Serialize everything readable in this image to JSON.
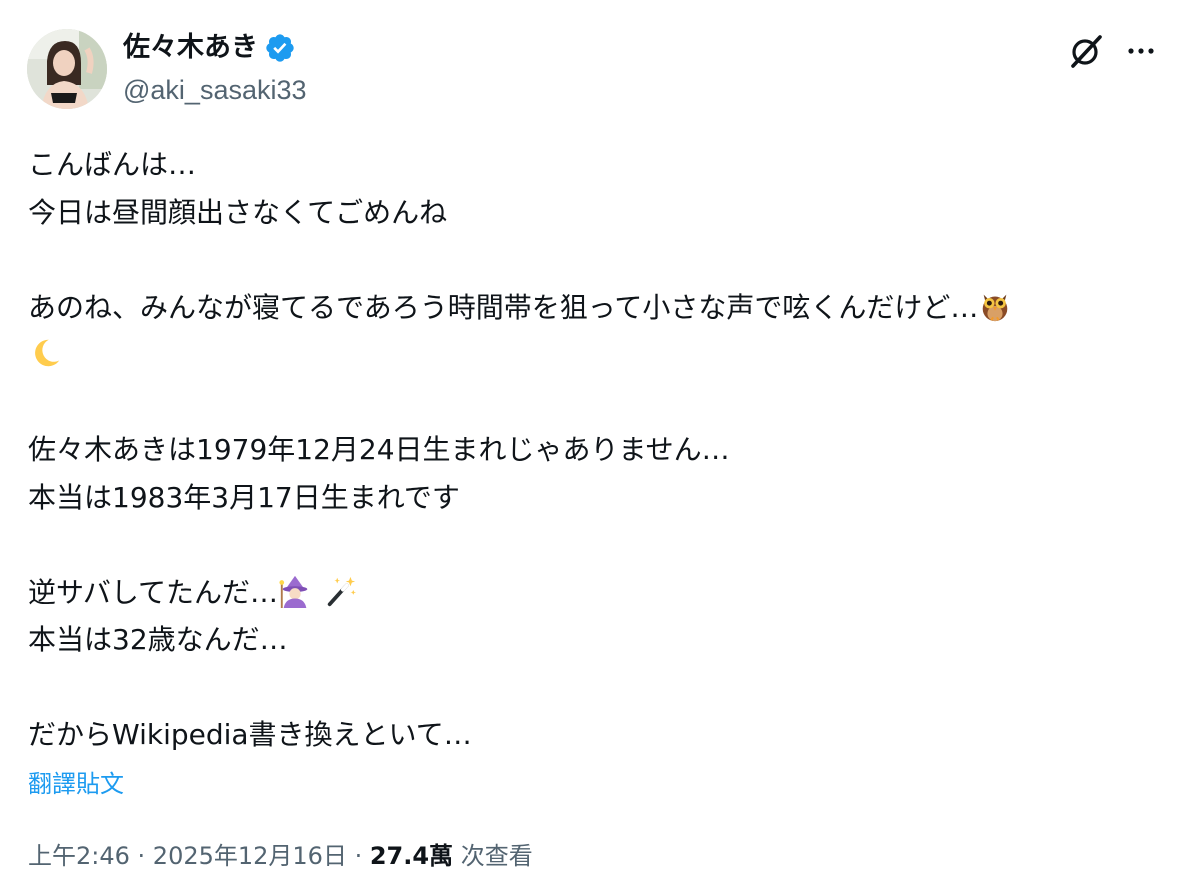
{
  "author": {
    "display_name": "佐々木あき",
    "handle": "@aki_sasaki33",
    "verified": true
  },
  "header_actions": {
    "grok_icon": "grok-icon",
    "more_icon": "more-icon"
  },
  "tweet": {
    "lines": {
      "l1": "こんばんは…",
      "l2": "今日は昼間顔出さなくてごめんね",
      "l3": "あのね、みんなが寝てるであろう時間帯を狙って小さな声で呟くんだけど…",
      "l4": "佐々木あきは1979年12月24日生まれじゃありません…",
      "l5": "本当は1983年3月17日生まれです",
      "l6": "逆サバしてたんだ…",
      "l7": "本当は32歳なんだ…",
      "l8": "だからWikipedia書き換えといて…"
    },
    "emojis": [
      "owl",
      "crescent-moon",
      "woman-mage",
      "magic-wand"
    ]
  },
  "translate_label": "翻譯貼文",
  "meta": {
    "time": "上午2:46",
    "sep1": " · ",
    "date": "2025年12月16日",
    "sep2": " · ",
    "views_count": "27.4萬",
    "views_label": " 次查看"
  },
  "colors": {
    "text": "#0f1419",
    "secondary": "#536471",
    "link": "#1d9bf0",
    "verified": "#1d9bf0"
  }
}
